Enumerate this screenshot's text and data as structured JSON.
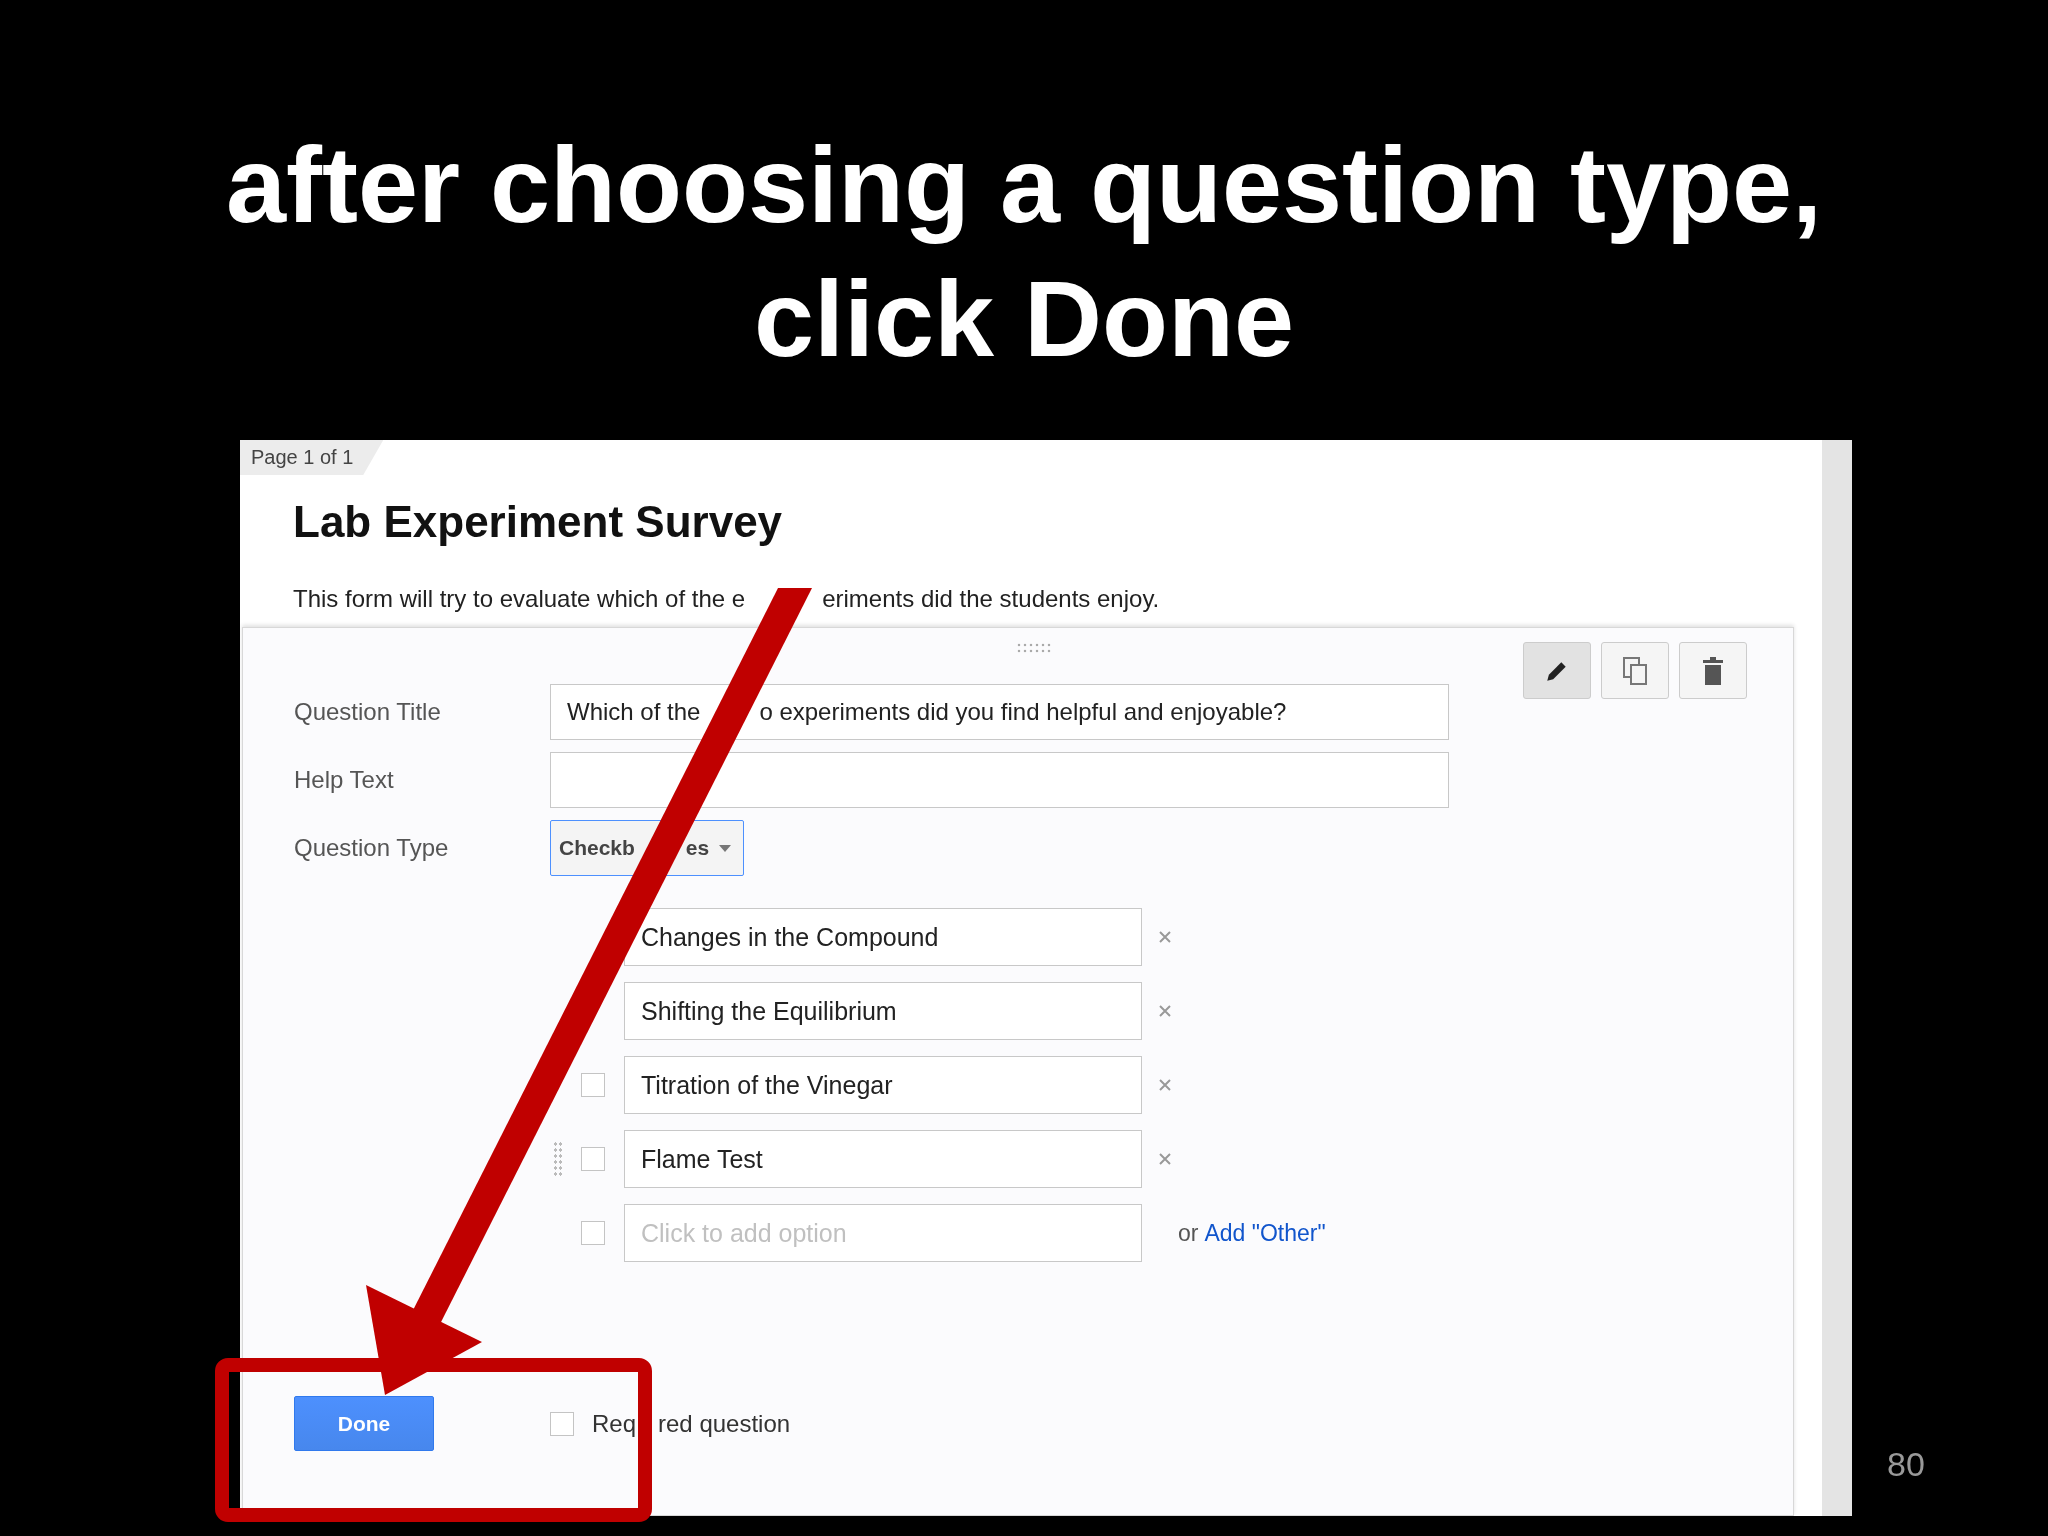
{
  "slide": {
    "title_lines": [
      "after choosing a question type,",
      "click Done"
    ],
    "page_number": "80"
  },
  "form": {
    "page_tab": "Page 1 of 1",
    "title": "Lab Experiment Survey",
    "description_parts": [
      "This form will try to evaluate which of the e",
      "eriments did the students enjoy."
    ],
    "question": {
      "fields": [
        {
          "label": "Question Title",
          "value_parts": [
            "Which of the",
            "o experiments did you find helpful and enjoyable?"
          ]
        },
        {
          "label": "Help Text"
        }
      ],
      "type_label": "Question Type",
      "type_value_parts": [
        "Checkb",
        "es"
      ],
      "options": [
        {
          "text": "Changes in the Compound"
        },
        {
          "text": "Shifting the Equilibrium"
        },
        {
          "text": "Titration of the Vinegar",
          "checked": false,
          "drag_handle": false
        },
        {
          "text": "Flame Test",
          "checked": false,
          "drag_handle": true
        }
      ],
      "add_option_placeholder": "Click to add option",
      "add_option_checked": false,
      "or_text": "or",
      "add_other": "Add \"Other\"",
      "done_button": "Done",
      "required": {
        "label_parts": [
          "Req",
          "red question"
        ],
        "checked": false
      }
    }
  }
}
